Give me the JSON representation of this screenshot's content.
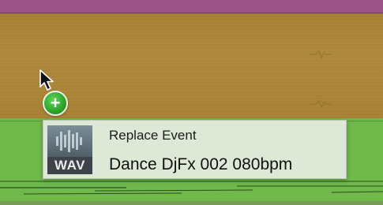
{
  "colors": {
    "top_strip": "#9a5586",
    "brown_track": "#a88138",
    "green_track": "#6fb84a",
    "tooltip_bg": "#dde9d6",
    "copy_badge": "#2ea32a"
  },
  "cursor": {
    "icon": "arrow-cursor-icon"
  },
  "copy_badge": {
    "icon": "plus-icon",
    "symbol": "+"
  },
  "drag_tooltip": {
    "file_type": "WAV",
    "action": "Replace Event",
    "file_name": "Dance DjFx 002 080bpm",
    "icon": "audio-file-icon"
  }
}
